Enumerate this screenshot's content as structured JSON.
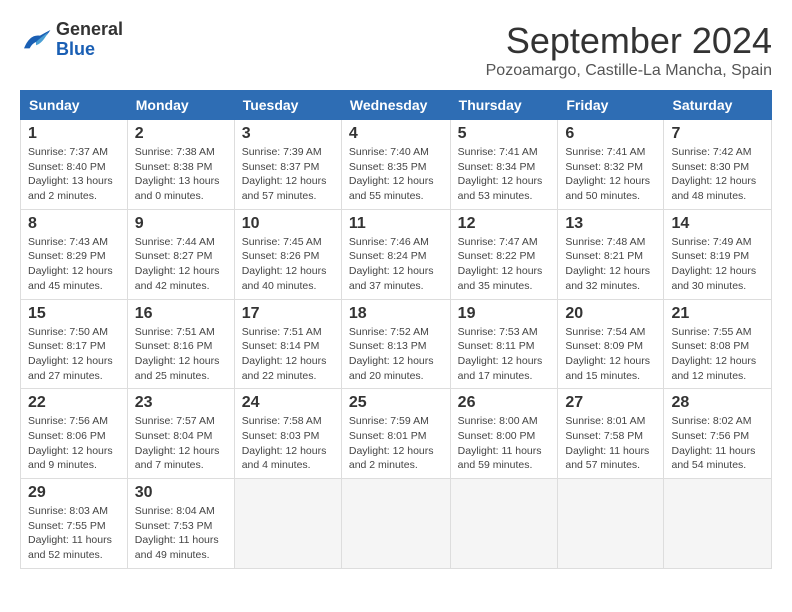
{
  "header": {
    "logo_general": "General",
    "logo_blue": "Blue",
    "month": "September 2024",
    "location": "Pozoamargo, Castille-La Mancha, Spain"
  },
  "weekdays": [
    "Sunday",
    "Monday",
    "Tuesday",
    "Wednesday",
    "Thursday",
    "Friday",
    "Saturday"
  ],
  "weeks": [
    [
      {
        "day": "1",
        "sunrise": "Sunrise: 7:37 AM",
        "sunset": "Sunset: 8:40 PM",
        "daylight": "Daylight: 13 hours and 2 minutes."
      },
      {
        "day": "2",
        "sunrise": "Sunrise: 7:38 AM",
        "sunset": "Sunset: 8:38 PM",
        "daylight": "Daylight: 13 hours and 0 minutes."
      },
      {
        "day": "3",
        "sunrise": "Sunrise: 7:39 AM",
        "sunset": "Sunset: 8:37 PM",
        "daylight": "Daylight: 12 hours and 57 minutes."
      },
      {
        "day": "4",
        "sunrise": "Sunrise: 7:40 AM",
        "sunset": "Sunset: 8:35 PM",
        "daylight": "Daylight: 12 hours and 55 minutes."
      },
      {
        "day": "5",
        "sunrise": "Sunrise: 7:41 AM",
        "sunset": "Sunset: 8:34 PM",
        "daylight": "Daylight: 12 hours and 53 minutes."
      },
      {
        "day": "6",
        "sunrise": "Sunrise: 7:41 AM",
        "sunset": "Sunset: 8:32 PM",
        "daylight": "Daylight: 12 hours and 50 minutes."
      },
      {
        "day": "7",
        "sunrise": "Sunrise: 7:42 AM",
        "sunset": "Sunset: 8:30 PM",
        "daylight": "Daylight: 12 hours and 48 minutes."
      }
    ],
    [
      {
        "day": "8",
        "sunrise": "Sunrise: 7:43 AM",
        "sunset": "Sunset: 8:29 PM",
        "daylight": "Daylight: 12 hours and 45 minutes."
      },
      {
        "day": "9",
        "sunrise": "Sunrise: 7:44 AM",
        "sunset": "Sunset: 8:27 PM",
        "daylight": "Daylight: 12 hours and 42 minutes."
      },
      {
        "day": "10",
        "sunrise": "Sunrise: 7:45 AM",
        "sunset": "Sunset: 8:26 PM",
        "daylight": "Daylight: 12 hours and 40 minutes."
      },
      {
        "day": "11",
        "sunrise": "Sunrise: 7:46 AM",
        "sunset": "Sunset: 8:24 PM",
        "daylight": "Daylight: 12 hours and 37 minutes."
      },
      {
        "day": "12",
        "sunrise": "Sunrise: 7:47 AM",
        "sunset": "Sunset: 8:22 PM",
        "daylight": "Daylight: 12 hours and 35 minutes."
      },
      {
        "day": "13",
        "sunrise": "Sunrise: 7:48 AM",
        "sunset": "Sunset: 8:21 PM",
        "daylight": "Daylight: 12 hours and 32 minutes."
      },
      {
        "day": "14",
        "sunrise": "Sunrise: 7:49 AM",
        "sunset": "Sunset: 8:19 PM",
        "daylight": "Daylight: 12 hours and 30 minutes."
      }
    ],
    [
      {
        "day": "15",
        "sunrise": "Sunrise: 7:50 AM",
        "sunset": "Sunset: 8:17 PM",
        "daylight": "Daylight: 12 hours and 27 minutes."
      },
      {
        "day": "16",
        "sunrise": "Sunrise: 7:51 AM",
        "sunset": "Sunset: 8:16 PM",
        "daylight": "Daylight: 12 hours and 25 minutes."
      },
      {
        "day": "17",
        "sunrise": "Sunrise: 7:51 AM",
        "sunset": "Sunset: 8:14 PM",
        "daylight": "Daylight: 12 hours and 22 minutes."
      },
      {
        "day": "18",
        "sunrise": "Sunrise: 7:52 AM",
        "sunset": "Sunset: 8:13 PM",
        "daylight": "Daylight: 12 hours and 20 minutes."
      },
      {
        "day": "19",
        "sunrise": "Sunrise: 7:53 AM",
        "sunset": "Sunset: 8:11 PM",
        "daylight": "Daylight: 12 hours and 17 minutes."
      },
      {
        "day": "20",
        "sunrise": "Sunrise: 7:54 AM",
        "sunset": "Sunset: 8:09 PM",
        "daylight": "Daylight: 12 hours and 15 minutes."
      },
      {
        "day": "21",
        "sunrise": "Sunrise: 7:55 AM",
        "sunset": "Sunset: 8:08 PM",
        "daylight": "Daylight: 12 hours and 12 minutes."
      }
    ],
    [
      {
        "day": "22",
        "sunrise": "Sunrise: 7:56 AM",
        "sunset": "Sunset: 8:06 PM",
        "daylight": "Daylight: 12 hours and 9 minutes."
      },
      {
        "day": "23",
        "sunrise": "Sunrise: 7:57 AM",
        "sunset": "Sunset: 8:04 PM",
        "daylight": "Daylight: 12 hours and 7 minutes."
      },
      {
        "day": "24",
        "sunrise": "Sunrise: 7:58 AM",
        "sunset": "Sunset: 8:03 PM",
        "daylight": "Daylight: 12 hours and 4 minutes."
      },
      {
        "day": "25",
        "sunrise": "Sunrise: 7:59 AM",
        "sunset": "Sunset: 8:01 PM",
        "daylight": "Daylight: 12 hours and 2 minutes."
      },
      {
        "day": "26",
        "sunrise": "Sunrise: 8:00 AM",
        "sunset": "Sunset: 8:00 PM",
        "daylight": "Daylight: 11 hours and 59 minutes."
      },
      {
        "day": "27",
        "sunrise": "Sunrise: 8:01 AM",
        "sunset": "Sunset: 7:58 PM",
        "daylight": "Daylight: 11 hours and 57 minutes."
      },
      {
        "day": "28",
        "sunrise": "Sunrise: 8:02 AM",
        "sunset": "Sunset: 7:56 PM",
        "daylight": "Daylight: 11 hours and 54 minutes."
      }
    ],
    [
      {
        "day": "29",
        "sunrise": "Sunrise: 8:03 AM",
        "sunset": "Sunset: 7:55 PM",
        "daylight": "Daylight: 11 hours and 52 minutes."
      },
      {
        "day": "30",
        "sunrise": "Sunrise: 8:04 AM",
        "sunset": "Sunset: 7:53 PM",
        "daylight": "Daylight: 11 hours and 49 minutes."
      },
      null,
      null,
      null,
      null,
      null
    ]
  ]
}
